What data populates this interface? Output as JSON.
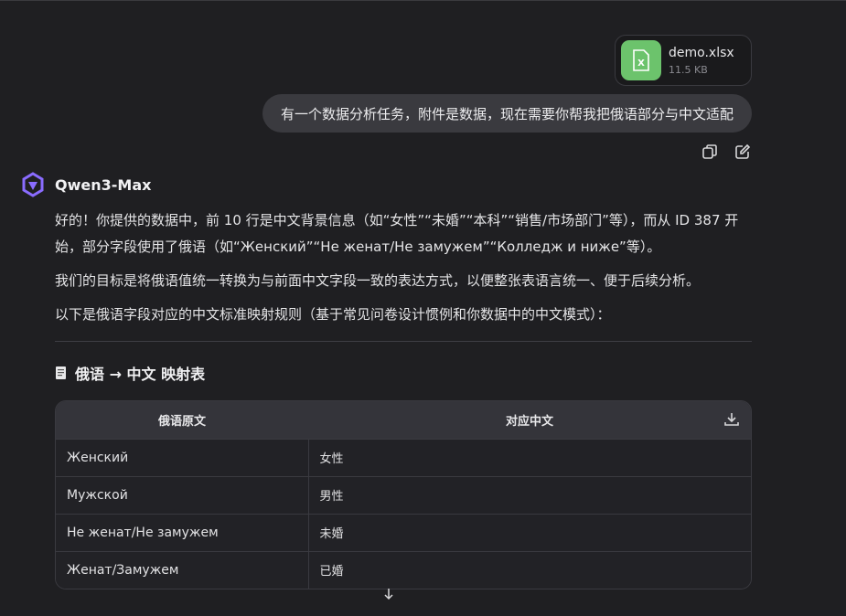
{
  "attachment": {
    "name": "demo.xlsx",
    "size": "11.5 KB",
    "icon": "xlsx-file-icon",
    "icon_color": "#6cc36c"
  },
  "user_message": {
    "text": "有一个数据分析任务，附件是数据，现在需要你帮我把俄语部分与中文适配"
  },
  "message_actions": {
    "copy_icon": "copy-icon",
    "edit_icon": "edit-icon"
  },
  "assistant": {
    "name": "Qwen3-Max",
    "logo": "qwen-logo-icon",
    "logo_color": "#7b5cff",
    "paragraphs": [
      "好的！你提供的数据中，前 10 行是中文背景信息（如“女性”“未婚”“本科”“销售/市场部门”等），而从 ID 387 开始，部分字段使用了俄语（如“Женский”“Не женат/Не замужем”“Колледж и ниже”等）。",
      "我们的目标是将俄语值统一转换为与前面中文字段一致的表达方式，以便整张表语言统一、便于后续分析。",
      "以下是俄语字段对应的中文标准映射规则（基于常见问卷设计惯例和你数据中的中文模式）："
    ],
    "section_title": "俄语 → 中文 映射表",
    "section_icon": "document-icon"
  },
  "table": {
    "headers": [
      "俄语原文",
      "对应中文"
    ],
    "rows": [
      [
        "Женский",
        "女性"
      ],
      [
        "Мужской",
        "男性"
      ],
      [
        "Не женат/Не замужем",
        "未婚"
      ],
      [
        "Женат/Замужем",
        "已婚"
      ]
    ],
    "download_icon": "download-icon"
  },
  "scroll_button": {
    "icon": "arrow-down-icon"
  }
}
